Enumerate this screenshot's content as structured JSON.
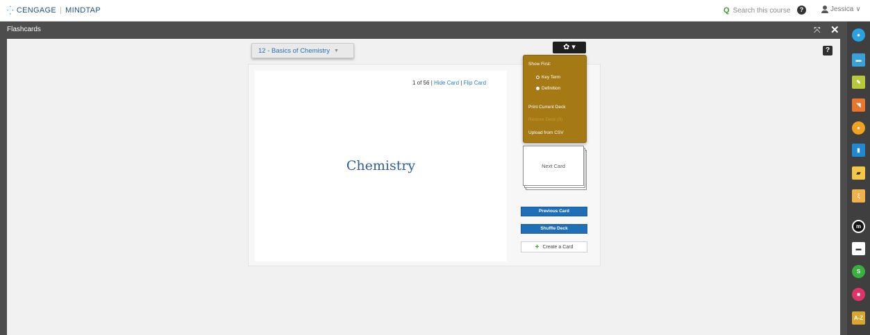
{
  "brand": {
    "logo_mark": "⁛",
    "name_left": "CENGAGE",
    "divider": "|",
    "name_right": "MINDTAP"
  },
  "topbar": {
    "search_placeholder": "Search this course",
    "search_icon": "Q",
    "help_icon": "?",
    "user_name": "Jessica",
    "user_caret": "∨"
  },
  "panel": {
    "title": "Flashcards",
    "expand_icon": "⤧",
    "close_icon": "✕",
    "help_icon": "?"
  },
  "deck": {
    "selected": "12 - Basics of Chemistry",
    "caret": "▼"
  },
  "card": {
    "counter": "1 of 56",
    "sep1": "|",
    "hide_label": "Hide Card",
    "sep2": "|",
    "flip_label": "Flip Card",
    "term": "Chemistry"
  },
  "settings": {
    "gear_label": "✿ ▾",
    "show_first_label": "Show First:",
    "options": [
      "Key Term",
      "Definition"
    ],
    "print_label": "Print Current Deck",
    "restore_label": "Restore Deck (0)",
    "upload_label": "Upload from CSV"
  },
  "controls": {
    "next_label": "Next Card",
    "previous_label": "Previous Card",
    "shuffle_label": "Shuffle Deck",
    "create_plus": "+",
    "create_label": "Create a Card"
  },
  "dock": [
    {
      "icon": "mindapp-icon",
      "glyph": "●",
      "color": "#2aa2e0"
    },
    {
      "icon": "briefcase-icon",
      "glyph": "▬",
      "color": "#3aa0d8"
    },
    {
      "icon": "highlighter-icon",
      "glyph": "✎",
      "color": "#b7c93a"
    },
    {
      "icon": "rss-icon",
      "glyph": "◥",
      "color": "#e8762c"
    },
    {
      "icon": "refresh-icon",
      "glyph": "●",
      "color": "#f2a21c"
    },
    {
      "icon": "book-icon",
      "glyph": "▮",
      "color": "#1f8ad0"
    },
    {
      "icon": "note-icon",
      "glyph": "▰",
      "color": "#f5c64a"
    },
    {
      "icon": "diagram-icon",
      "glyph": "ξ",
      "color": "#f0b24a"
    },
    {
      "icon": "m-app-icon",
      "glyph": "m",
      "color": "#111111"
    },
    {
      "icon": "chat-icon",
      "glyph": "▬",
      "color": "#ffffff"
    },
    {
      "icon": "s-app-icon",
      "glyph": "S",
      "color": "#3ab03e"
    },
    {
      "icon": "message-icon",
      "glyph": "■",
      "color": "#e0336a"
    },
    {
      "icon": "glossary-icon",
      "glyph": "A-Z",
      "color": "#d9a72a"
    }
  ]
}
